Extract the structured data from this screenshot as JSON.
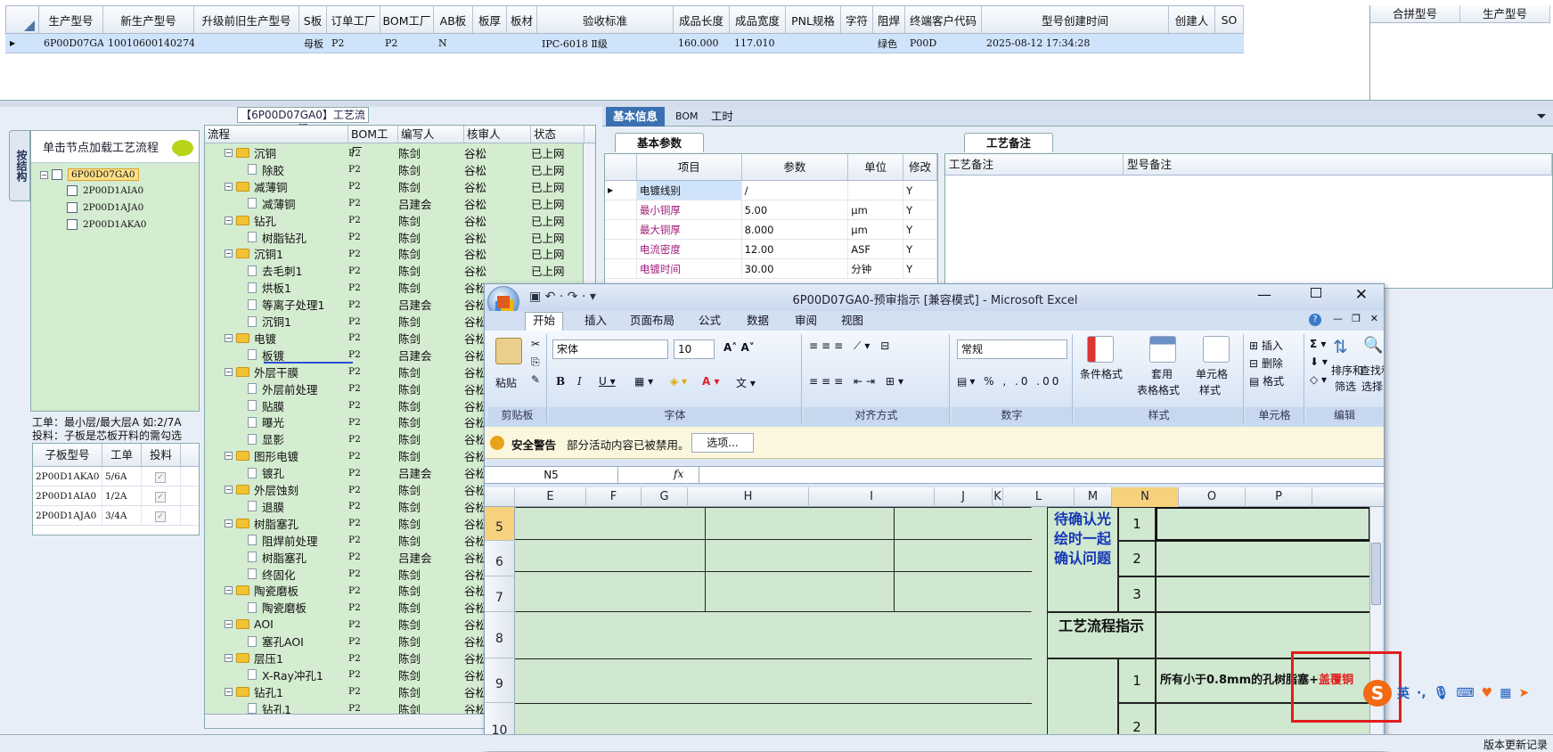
{
  "main_grid": {
    "headers": [
      "生产型号",
      "新生产型号",
      "升级前旧生产型号",
      "S板",
      "订单工厂",
      "BOM工厂",
      "AB板",
      "板厚",
      "板材",
      "验收标准",
      "成品长度",
      "成品宽度",
      "PNL规格",
      "字符",
      "阻焊",
      "终端客户代码",
      "型号创建时间",
      "创建人",
      "SO"
    ],
    "row": [
      "6P00D07GA0",
      "10010600140274",
      "",
      "母板",
      "P2",
      "P2",
      "N",
      "",
      "",
      "IPC-6018 Ⅱ级",
      "160.000",
      "117.010",
      "",
      "",
      "绿色",
      "P00D",
      "2025-08-12 17:34:28",
      "",
      ""
    ],
    "right_headers": [
      "合拼型号",
      "生产型号"
    ]
  },
  "process_panel": {
    "title": "【6P00D07GA0】工艺流程",
    "side_tab": "按结构",
    "tree_hint": "单击节点加载工艺流程",
    "root": "6P00D07GA0",
    "children": [
      "2P00D1AIA0",
      "2P00D1AJA0",
      "2P00D1AKA0"
    ],
    "info_line1": "工单：最小层/最大层A 如:2/7A",
    "info_line2": "投料：子板是芯板开料的需勾选",
    "sub_headers": [
      "子板型号",
      "工单",
      "投料"
    ],
    "sub_rows": [
      [
        "2P00D1AKA0",
        "5/6A"
      ],
      [
        "2P00D1AIA0",
        "1/2A"
      ],
      [
        "2P00D1AJA0",
        "3/4A"
      ]
    ]
  },
  "flow": {
    "headers": [
      "流程",
      "BOM工厂",
      "编写人",
      "核审人",
      "状态"
    ],
    "rows": [
      {
        "n": "沉铜",
        "lv": 0,
        "f": "P2",
        "w": "陈剑",
        "r": "谷松",
        "s": "已上网"
      },
      {
        "n": "除胶",
        "lv": 1,
        "f": "P2",
        "w": "陈剑",
        "r": "谷松",
        "s": "已上网"
      },
      {
        "n": "减薄铜",
        "lv": 0,
        "f": "P2",
        "w": "陈剑",
        "r": "谷松",
        "s": "已上网"
      },
      {
        "n": "减薄铜",
        "lv": 1,
        "f": "P2",
        "w": "吕建会",
        "r": "谷松",
        "s": "已上网"
      },
      {
        "n": "钻孔",
        "lv": 0,
        "f": "P2",
        "w": "陈剑",
        "r": "谷松",
        "s": "已上网"
      },
      {
        "n": "树脂钻孔",
        "lv": 1,
        "f": "P2",
        "w": "陈剑",
        "r": "谷松",
        "s": "已上网"
      },
      {
        "n": "沉铜1",
        "lv": 0,
        "f": "P2",
        "w": "陈剑",
        "r": "谷松",
        "s": "已上网"
      },
      {
        "n": "去毛刺1",
        "lv": 1,
        "f": "P2",
        "w": "陈剑",
        "r": "谷松",
        "s": "已上网"
      },
      {
        "n": "烘板1",
        "lv": 1,
        "f": "P2",
        "w": "陈剑",
        "r": "谷松",
        "s": ""
      },
      {
        "n": "等离子处理1",
        "lv": 1,
        "f": "P2",
        "w": "吕建会",
        "r": "谷松",
        "s": ""
      },
      {
        "n": "沉铜1",
        "lv": 1,
        "f": "P2",
        "w": "陈剑",
        "r": "谷松",
        "s": ""
      },
      {
        "n": "电镀",
        "lv": 0,
        "f": "P2",
        "w": "陈剑",
        "r": "谷松",
        "s": ""
      },
      {
        "n": "板镀",
        "lv": 1,
        "f": "P2",
        "w": "吕建会",
        "r": "谷松",
        "s": ""
      },
      {
        "n": "外层干膜",
        "lv": 0,
        "f": "P2",
        "w": "陈剑",
        "r": "谷松",
        "s": ""
      },
      {
        "n": "外层前处理",
        "lv": 1,
        "f": "P2",
        "w": "陈剑",
        "r": "谷松",
        "s": ""
      },
      {
        "n": "贴膜",
        "lv": 1,
        "f": "P2",
        "w": "陈剑",
        "r": "谷松",
        "s": ""
      },
      {
        "n": "曝光",
        "lv": 1,
        "f": "P2",
        "w": "陈剑",
        "r": "谷松",
        "s": ""
      },
      {
        "n": "显影",
        "lv": 1,
        "f": "P2",
        "w": "陈剑",
        "r": "谷松",
        "s": ""
      },
      {
        "n": "图形电镀",
        "lv": 0,
        "f": "P2",
        "w": "陈剑",
        "r": "谷松",
        "s": ""
      },
      {
        "n": "镀孔",
        "lv": 1,
        "f": "P2",
        "w": "吕建会",
        "r": "谷松",
        "s": ""
      },
      {
        "n": "外层蚀刻",
        "lv": 0,
        "f": "P2",
        "w": "陈剑",
        "r": "谷松",
        "s": ""
      },
      {
        "n": "退膜",
        "lv": 1,
        "f": "P2",
        "w": "陈剑",
        "r": "谷松",
        "s": ""
      },
      {
        "n": "树脂塞孔",
        "lv": 0,
        "f": "P2",
        "w": "陈剑",
        "r": "谷松",
        "s": ""
      },
      {
        "n": "阻焊前处理",
        "lv": 1,
        "f": "P2",
        "w": "陈剑",
        "r": "谷松",
        "s": ""
      },
      {
        "n": "树脂塞孔",
        "lv": 1,
        "f": "P2",
        "w": "吕建会",
        "r": "谷松",
        "s": ""
      },
      {
        "n": "终固化",
        "lv": 1,
        "f": "P2",
        "w": "陈剑",
        "r": "谷松",
        "s": ""
      },
      {
        "n": "陶瓷磨板",
        "lv": 0,
        "f": "P2",
        "w": "陈剑",
        "r": "谷松",
        "s": ""
      },
      {
        "n": "陶瓷磨板",
        "lv": 1,
        "f": "P2",
        "w": "陈剑",
        "r": "谷松",
        "s": ""
      },
      {
        "n": "AOI",
        "lv": 0,
        "f": "P2",
        "w": "陈剑",
        "r": "谷松",
        "s": ""
      },
      {
        "n": "塞孔AOI",
        "lv": 1,
        "f": "P2",
        "w": "陈剑",
        "r": "谷松",
        "s": ""
      },
      {
        "n": "层压1",
        "lv": 0,
        "f": "P2",
        "w": "陈剑",
        "r": "谷松",
        "s": ""
      },
      {
        "n": "X-Ray冲孔1",
        "lv": 1,
        "f": "P2",
        "w": "陈剑",
        "r": "谷松",
        "s": ""
      },
      {
        "n": "钻孔1",
        "lv": 0,
        "f": "P2",
        "w": "陈剑",
        "r": "谷松",
        "s": ""
      },
      {
        "n": "钻孔1",
        "lv": 1,
        "f": "P2",
        "w": "陈剑",
        "r": "谷松",
        "s": ""
      }
    ]
  },
  "right_panel": {
    "tabs": [
      "基本信息",
      "BOM",
      "工时"
    ],
    "subtab1": "基本参数",
    "subtab2": "工艺备注",
    "param_headers": [
      "项目",
      "参数",
      "单位",
      "修改"
    ],
    "params": [
      [
        "电镀线别",
        "/",
        "",
        "Y"
      ],
      [
        "最小铜厚",
        "5.00",
        "μm",
        "Y"
      ],
      [
        "最大铜厚",
        "8.000",
        "μm",
        "Y"
      ],
      [
        "电流密度",
        "12.00",
        "ASF",
        "Y"
      ],
      [
        "电镀时间",
        "30.00",
        "分钟",
        "Y"
      ]
    ],
    "remark_headers": [
      "工艺备注",
      "型号备注"
    ]
  },
  "excel": {
    "title": "6P00D07GA0-预审指示 [兼容模式] - Microsoft Excel",
    "menu": [
      "开始",
      "插入",
      "页面布局",
      "公式",
      "数据",
      "审阅",
      "视图"
    ],
    "clipboard": {
      "paste": "粘贴",
      "label": "剪贴板"
    },
    "font": {
      "name": "宋体",
      "size": "10",
      "label": "字体"
    },
    "align_label": "对齐方式",
    "number": {
      "format": "常规",
      "label": "数字"
    },
    "styles": {
      "cond": "条件格式",
      "table1": "套用",
      "table2": "表格格式",
      "cell1": "单元格",
      "cell2": "样式",
      "label": "样式"
    },
    "cells": {
      "insert": "插入",
      "delete": "删除",
      "format": "格式",
      "label": "单元格"
    },
    "edit": {
      "sort1": "排序和",
      "sort2": "筛选",
      "find1": "查找和",
      "find2": "选择",
      "label": "编辑"
    },
    "security": {
      "title": "安全警告",
      "msg": "部分活动内容已被禁用。",
      "btn": "选项..."
    },
    "namebox": "N5",
    "fx": "fx",
    "columns": [
      "E",
      "F",
      "G",
      "H",
      "I",
      "J",
      "K",
      "L",
      "M",
      "N",
      "O",
      "P"
    ],
    "rows": [
      "5",
      "6",
      "7",
      "8",
      "9",
      "10"
    ],
    "cell_confirm": "待确认光绘时一起确认问题",
    "n1": "1",
    "n2": "2",
    "n3": "3",
    "cell_process": "工艺流程指示",
    "p1": "1",
    "p2": "2",
    "instr_black": "所有小于0.8mm的孔树脂塞+",
    "instr_red": "盖覆铜"
  },
  "ime": {
    "lang": "英"
  },
  "status": {
    "right": "版本更新记录"
  }
}
